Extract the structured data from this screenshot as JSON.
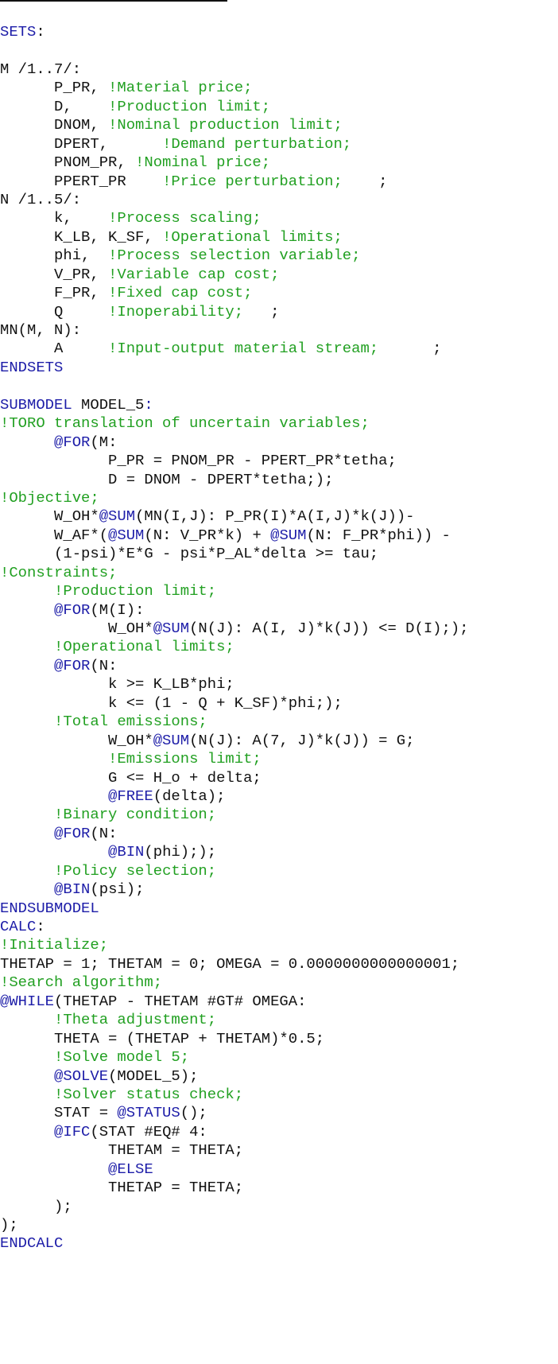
{
  "document": {
    "type": "LINGO model listing",
    "lines": [
      [
        [
          "kw",
          "SETS"
        ],
        [
          "tx",
          ":"
        ]
      ],
      [],
      [
        [
          "tx",
          "M /1..7/:"
        ]
      ],
      [
        [
          "tx",
          "      P_PR, "
        ],
        [
          "cm",
          "!Material price;"
        ]
      ],
      [
        [
          "tx",
          "      D,    "
        ],
        [
          "cm",
          "!Production limit;"
        ]
      ],
      [
        [
          "tx",
          "      DNOM, "
        ],
        [
          "cm",
          "!Nominal production limit;"
        ]
      ],
      [
        [
          "tx",
          "      DPERT,      "
        ],
        [
          "cm",
          "!Demand perturbation;"
        ]
      ],
      [
        [
          "tx",
          "      PNOM_PR, "
        ],
        [
          "cm",
          "!Nominal price;"
        ]
      ],
      [
        [
          "tx",
          "      PPERT_PR    "
        ],
        [
          "cm",
          "!Price perturbation;"
        ],
        [
          "tx",
          "    ;"
        ]
      ],
      [
        [
          "tx",
          "N /1..5/:"
        ]
      ],
      [
        [
          "tx",
          "      k,    "
        ],
        [
          "cm",
          "!Process scaling;"
        ]
      ],
      [
        [
          "tx",
          "      K_LB, K_SF, "
        ],
        [
          "cm",
          "!Operational limits;"
        ]
      ],
      [
        [
          "tx",
          "      phi,  "
        ],
        [
          "cm",
          "!Process selection variable;"
        ]
      ],
      [
        [
          "tx",
          "      V_PR, "
        ],
        [
          "cm",
          "!Variable cap cost;"
        ]
      ],
      [
        [
          "tx",
          "      F_PR, "
        ],
        [
          "cm",
          "!Fixed cap cost;"
        ]
      ],
      [
        [
          "tx",
          "      Q     "
        ],
        [
          "cm",
          "!Inoperability;"
        ],
        [
          "tx",
          "   ;"
        ]
      ],
      [
        [
          "tx",
          "MN(M, N):"
        ]
      ],
      [
        [
          "tx",
          "      A     "
        ],
        [
          "cm",
          "!Input-output material stream;"
        ],
        [
          "tx",
          "      ;"
        ]
      ],
      [
        [
          "kw",
          "ENDSETS"
        ]
      ],
      [],
      [
        [
          "kw",
          "SUBMODEL"
        ],
        [
          "tx",
          " MODEL_5"
        ],
        [
          "kw",
          ":"
        ]
      ],
      [
        [
          "cm",
          "!TORO translation of uncertain variables;"
        ]
      ],
      [
        [
          "tx",
          "      "
        ],
        [
          "kw",
          "@FOR"
        ],
        [
          "tx",
          "(M:"
        ]
      ],
      [
        [
          "tx",
          "            P_PR = PNOM_PR - PPERT_PR*tetha;"
        ]
      ],
      [
        [
          "tx",
          "            D = DNOM - DPERT*tetha;);"
        ]
      ],
      [
        [
          "cm",
          "!Objective;"
        ]
      ],
      [
        [
          "tx",
          "      W_OH*"
        ],
        [
          "kw",
          "@SUM"
        ],
        [
          "tx",
          "(MN(I,J): P_PR(I)*A(I,J)*k(J))-"
        ]
      ],
      [
        [
          "tx",
          "      W_AF*("
        ],
        [
          "kw",
          "@SUM"
        ],
        [
          "tx",
          "(N: V_PR*k) + "
        ],
        [
          "kw",
          "@SUM"
        ],
        [
          "tx",
          "(N: F_PR*phi)) -"
        ]
      ],
      [
        [
          "tx",
          "      (1-psi)*E*G - psi*P_AL*delta >= tau;"
        ]
      ],
      [
        [
          "cm",
          "!Constraints;"
        ]
      ],
      [
        [
          "tx",
          "      "
        ],
        [
          "cm",
          "!Production limit;"
        ]
      ],
      [
        [
          "tx",
          "      "
        ],
        [
          "kw",
          "@FOR"
        ],
        [
          "tx",
          "(M(I):"
        ]
      ],
      [
        [
          "tx",
          "            W_OH*"
        ],
        [
          "kw",
          "@SUM"
        ],
        [
          "tx",
          "(N(J): A(I, J)*k(J)) <= D(I););"
        ]
      ],
      [
        [
          "tx",
          "      "
        ],
        [
          "cm",
          "!Operational limits;"
        ]
      ],
      [
        [
          "tx",
          "      "
        ],
        [
          "kw",
          "@FOR"
        ],
        [
          "tx",
          "(N:"
        ]
      ],
      [
        [
          "tx",
          "            k >= K_LB*phi;"
        ]
      ],
      [
        [
          "tx",
          "            k <= (1 - Q + K_SF)*phi;);"
        ]
      ],
      [
        [
          "tx",
          "      "
        ],
        [
          "cm",
          "!Total emissions;"
        ]
      ],
      [
        [
          "tx",
          "            W_OH*"
        ],
        [
          "kw",
          "@SUM"
        ],
        [
          "tx",
          "(N(J): A(7, J)*k(J)) = G;"
        ]
      ],
      [
        [
          "tx",
          "            "
        ],
        [
          "cm",
          "!Emissions limit;"
        ]
      ],
      [
        [
          "tx",
          "            G <= H_o + delta;"
        ]
      ],
      [
        [
          "tx",
          "            "
        ],
        [
          "kw",
          "@FREE"
        ],
        [
          "tx",
          "(delta);"
        ]
      ],
      [
        [
          "tx",
          "      "
        ],
        [
          "cm",
          "!Binary condition;"
        ]
      ],
      [
        [
          "tx",
          "      "
        ],
        [
          "kw",
          "@FOR"
        ],
        [
          "tx",
          "(N:"
        ]
      ],
      [
        [
          "tx",
          "            "
        ],
        [
          "kw",
          "@BIN"
        ],
        [
          "tx",
          "(phi););"
        ]
      ],
      [
        [
          "tx",
          "      "
        ],
        [
          "cm",
          "!Policy selection;"
        ]
      ],
      [
        [
          "tx",
          "      "
        ],
        [
          "kw",
          "@BIN"
        ],
        [
          "tx",
          "(psi);"
        ]
      ],
      [
        [
          "kw",
          "ENDSUBMODEL"
        ]
      ],
      [
        [
          "kw",
          "CALC"
        ],
        [
          "tx",
          ":"
        ]
      ],
      [
        [
          "cm",
          "!Initialize;"
        ]
      ],
      [
        [
          "tx",
          "THETAP = 1; THETAM = 0; OMEGA = 0.0000000000000001;"
        ]
      ],
      [
        [
          "cm",
          "!Search algorithm;"
        ]
      ],
      [
        [
          "kw",
          "@WHILE"
        ],
        [
          "tx",
          "(THETAP - THETAM #GT# OMEGA:"
        ]
      ],
      [
        [
          "tx",
          "      "
        ],
        [
          "cm",
          "!Theta adjustment;"
        ]
      ],
      [
        [
          "tx",
          "      THETA = (THETAP + THETAM)*0.5;"
        ]
      ],
      [
        [
          "tx",
          "      "
        ],
        [
          "cm",
          "!Solve model 5;"
        ]
      ],
      [
        [
          "tx",
          "      "
        ],
        [
          "kw",
          "@SOLVE"
        ],
        [
          "tx",
          "(MODEL_5);"
        ]
      ],
      [
        [
          "tx",
          "      "
        ],
        [
          "cm",
          "!Solver status check;"
        ]
      ],
      [
        [
          "tx",
          "      STAT = "
        ],
        [
          "kw",
          "@STATUS"
        ],
        [
          "tx",
          "();"
        ]
      ],
      [
        [
          "tx",
          "      "
        ],
        [
          "kw",
          "@IFC"
        ],
        [
          "tx",
          "(STAT #EQ# 4:"
        ]
      ],
      [
        [
          "tx",
          "            THETAM = THETA;"
        ]
      ],
      [
        [
          "tx",
          "            "
        ],
        [
          "kw",
          "@ELSE"
        ]
      ],
      [
        [
          "tx",
          "            THETAP = THETA;"
        ]
      ],
      [
        [
          "tx",
          "      );"
        ]
      ],
      [
        [
          "tx",
          ");"
        ]
      ],
      [
        [
          "kw",
          "ENDCALC"
        ]
      ]
    ]
  },
  "colors": {
    "keyword": "#1d1da8",
    "comment": "#22a022",
    "text": "#111111",
    "background": "#ffffff"
  }
}
